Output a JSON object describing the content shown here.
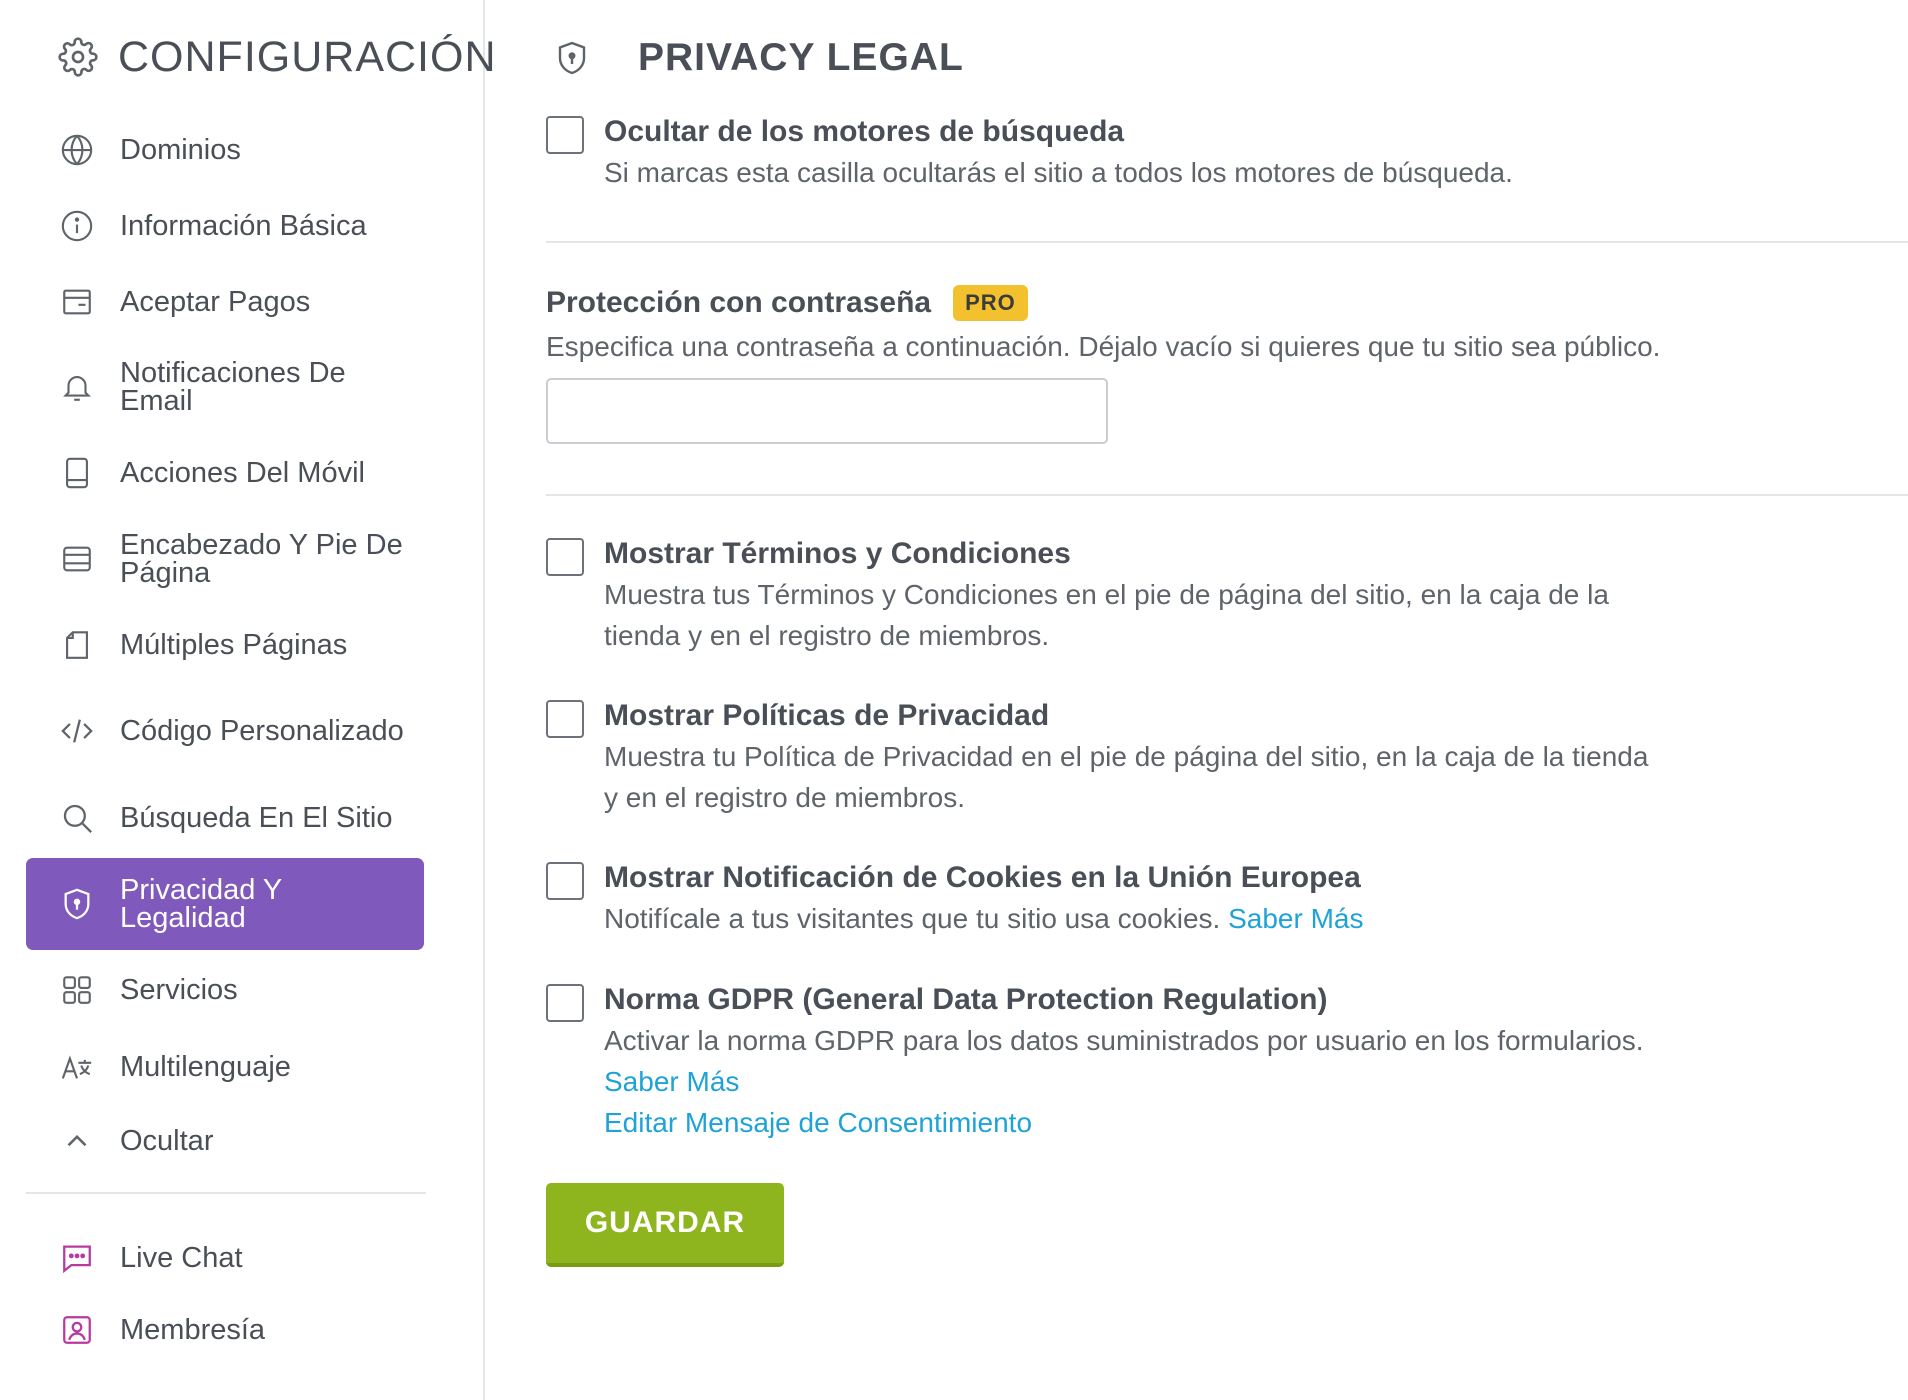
{
  "sidebar": {
    "title": "CONFIGURACIÓN",
    "items": [
      {
        "label": "Dominios",
        "icon": "globe-icon"
      },
      {
        "label": "Información Básica",
        "icon": "info-icon"
      },
      {
        "label": "Aceptar Pagos",
        "icon": "wallet-icon"
      },
      {
        "label": "Notificaciones De Email",
        "icon": "bell-icon"
      },
      {
        "label": "Acciones Del Móvil",
        "icon": "mobile-icon"
      },
      {
        "label": "Encabezado Y Pie De Página",
        "icon": "header-footer-icon"
      },
      {
        "label": "Múltiples Páginas",
        "icon": "pages-icon"
      },
      {
        "label": "Código Personalizado",
        "icon": "code-icon"
      },
      {
        "label": "Búsqueda En El Sitio",
        "icon": "search-icon"
      },
      {
        "label": "Privacidad Y Legalidad",
        "icon": "shield-icon",
        "active": true
      },
      {
        "label": "Servicios",
        "icon": "grid-icon"
      },
      {
        "label": "Multilenguaje",
        "icon": "language-icon"
      },
      {
        "label": "Ocultar",
        "icon": "chevron-up-icon"
      }
    ],
    "extra_items": [
      {
        "label": "Live Chat",
        "icon": "chat-icon"
      },
      {
        "label": "Membresía",
        "icon": "member-icon"
      }
    ]
  },
  "main": {
    "title": "PRIVACY LEGAL",
    "hide_search": {
      "title": "Ocultar de los motores de búsqueda",
      "desc": "Si marcas esta casilla ocultarás el sitio a todos los motores de búsqueda.",
      "checked": false
    },
    "password": {
      "title": "Protección con contraseña",
      "badge": "PRO",
      "desc": "Especifica una contraseña a continuación. Déjalo vacío si quieres que tu sitio sea público.",
      "value": ""
    },
    "terms": {
      "title": "Mostrar Términos y Condiciones",
      "desc_line1": "Muestra tus Términos y Condiciones en el pie de página del sitio, en la caja de la",
      "desc_line2": "tienda y en el registro de miembros.",
      "checked": false
    },
    "privacy": {
      "title": "Mostrar Políticas de Privacidad",
      "desc_line1": "Muestra tu Política de Privacidad en el pie de página del sitio, en la caja de la tienda",
      "desc_line2": "y en el registro de miembros.",
      "checked": false
    },
    "cookies": {
      "title": "Mostrar Notificación de Cookies en la Unión Europea",
      "desc": "Notifícale a tus visitantes que tu sitio usa cookies.",
      "link": "Saber Más",
      "checked": false
    },
    "gdpr": {
      "title": "Norma GDPR (General Data Protection Regulation)",
      "desc": "Activar la norma GDPR para los datos suministrados por usuario en los formularios.",
      "link1": "Saber Más",
      "link2": "Editar Mensaje de Consentimiento",
      "checked": false
    },
    "save_label": "GUARDAR"
  }
}
